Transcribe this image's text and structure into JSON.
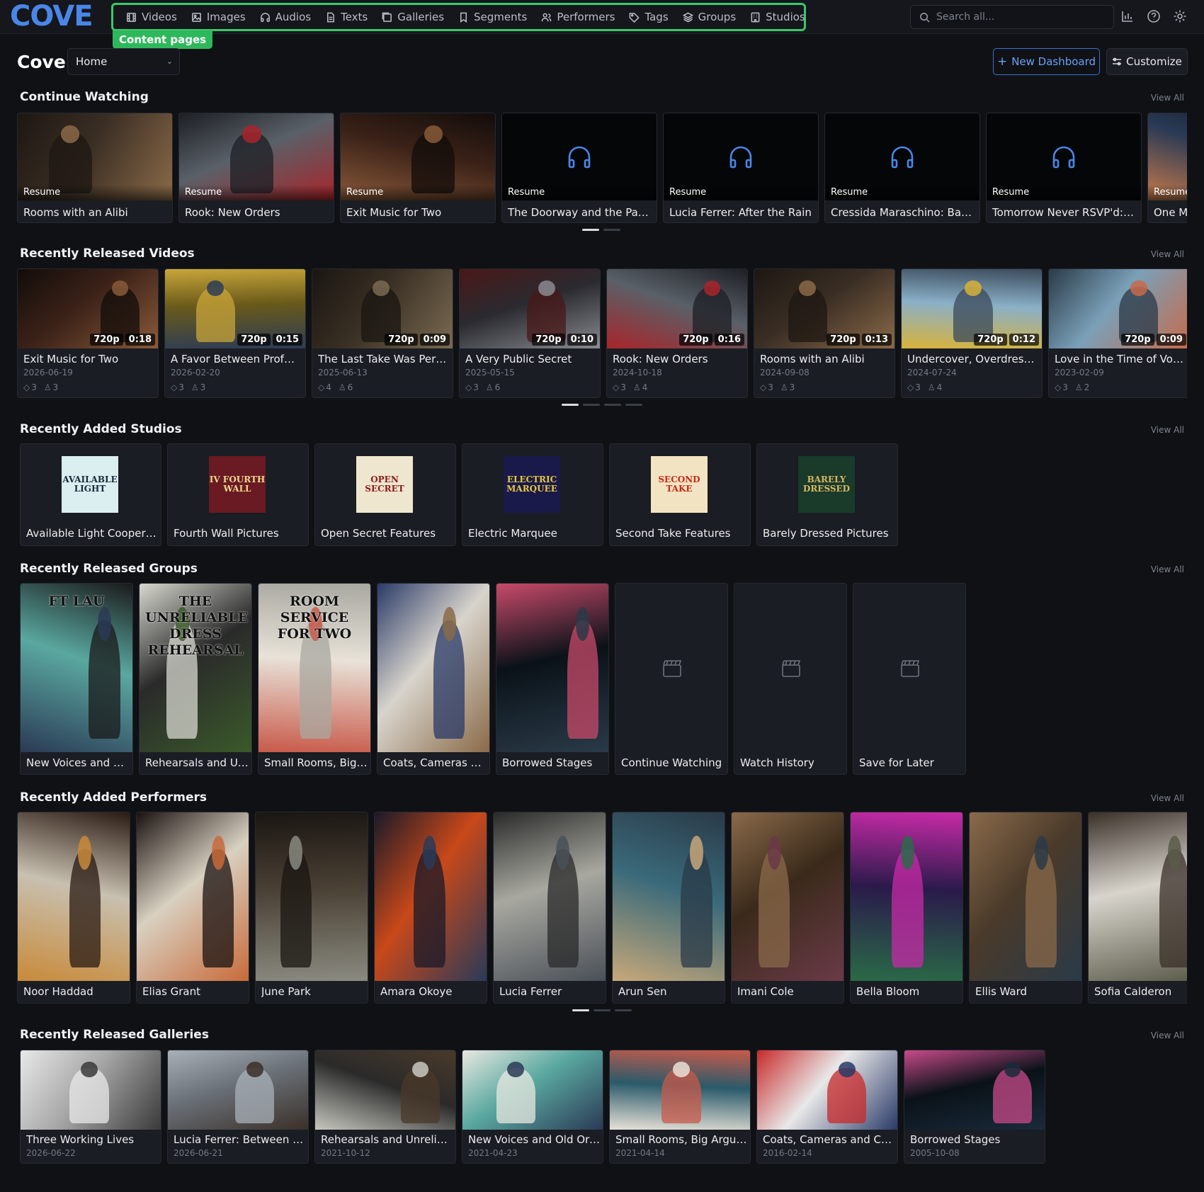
{
  "app": {
    "logo": "COVE",
    "nav_tag": "Content pages"
  },
  "nav": [
    {
      "label": "Videos",
      "icon": "film-icon"
    },
    {
      "label": "Images",
      "icon": "image-icon"
    },
    {
      "label": "Audios",
      "icon": "headphones-icon"
    },
    {
      "label": "Texts",
      "icon": "document-icon"
    },
    {
      "label": "Galleries",
      "icon": "gallery-icon"
    },
    {
      "label": "Segments",
      "icon": "bookmark-icon"
    },
    {
      "label": "Performers",
      "icon": "users-icon"
    },
    {
      "label": "Tags",
      "icon": "tag-icon"
    },
    {
      "label": "Groups",
      "icon": "layers-icon"
    },
    {
      "label": "Studios",
      "icon": "building-icon"
    }
  ],
  "search": {
    "placeholder": "Search all..."
  },
  "header": {
    "title": "Cove",
    "dashboard_select": "Home",
    "new_dashboard": "New Dashboard",
    "customize": "Customize"
  },
  "view_all": "View All",
  "continue_watching": {
    "title": "Continue Watching",
    "resume_label": "Resume",
    "items": [
      {
        "title": "Rooms with an Alibi",
        "kind": "video",
        "palette": [
          "#3a2e24",
          "#8b6a48",
          "#1d1712"
        ]
      },
      {
        "title": "Rook: New Orders",
        "kind": "video",
        "palette": [
          "#5a6068",
          "#a8252a",
          "#1c1f24"
        ]
      },
      {
        "title": "Exit Music for Two",
        "kind": "video",
        "palette": [
          "#3c2218",
          "#8a5a3a",
          "#120c0a"
        ]
      },
      {
        "title": "The Doorway and the Pause",
        "kind": "audio"
      },
      {
        "title": "Lucia Ferrer: After the Rain",
        "kind": "audio"
      },
      {
        "title": "Cressida Maraschino: Back o...",
        "kind": "audio"
      },
      {
        "title": "Tomorrow Never RSVP'd: Lau...",
        "kind": "audio"
      },
      {
        "title": "One Mo",
        "kind": "video",
        "palette": [
          "#2a3a55",
          "#c77a4a",
          "#0f1522"
        ]
      }
    ]
  },
  "recent_videos": {
    "title": "Recently Released Videos",
    "items": [
      {
        "title": "Exit Music for Two",
        "date": "2026-06-19",
        "res": "720p",
        "dur": "0:18",
        "tags": "3",
        "perf": "3",
        "palette": [
          "#3c2218",
          "#8a5a3a",
          "#120c0a"
        ]
      },
      {
        "title": "A Favor Between Professi...",
        "date": "2026-02-20",
        "res": "720p",
        "dur": "0:15",
        "tags": "3",
        "perf": "3",
        "palette": [
          "#6a5a1a",
          "#2c3c55",
          "#c9a63a"
        ]
      },
      {
        "title": "The Last Take Was Perfect",
        "date": "2025-06-13",
        "res": "720p",
        "dur": "0:09",
        "tags": "4",
        "perf": "6",
        "palette": [
          "#3a3024",
          "#7a6a52",
          "#1a1612"
        ]
      },
      {
        "title": "A Very Public Secret",
        "date": "2025-05-15",
        "res": "720p",
        "dur": "0:10",
        "tags": "3",
        "perf": "6",
        "palette": [
          "#2a2a30",
          "#8a8a92",
          "#4a1818"
        ]
      },
      {
        "title": "Rook: New Orders",
        "date": "2024-10-18",
        "res": "720p",
        "dur": "0:16",
        "tags": "3",
        "perf": "4",
        "palette": [
          "#5a6068",
          "#a8252a",
          "#1c1f24"
        ]
      },
      {
        "title": "Rooms with an Alibi",
        "date": "2024-09-08",
        "res": "720p",
        "dur": "0:13",
        "tags": "3",
        "perf": "3",
        "palette": [
          "#3a2e24",
          "#8b6a48",
          "#1d1712"
        ]
      },
      {
        "title": "Undercover, Overdressed",
        "date": "2024-07-24",
        "res": "720p",
        "dur": "0:12",
        "tags": "3",
        "perf": "4",
        "palette": [
          "#8ab0c8",
          "#d8b23a",
          "#3a4a5a"
        ]
      },
      {
        "title": "Love in the Time of Voice...",
        "date": "2023-02-09",
        "res": "720p",
        "dur": "0:09",
        "tags": "3",
        "perf": "2",
        "palette": [
          "#7aa0b8",
          "#c86a4a",
          "#2a3a48"
        ]
      }
    ]
  },
  "recent_studios": {
    "title": "Recently Added Studios",
    "items": [
      {
        "name": "Available Light Cooperative",
        "logo": "AVAILABLE LIGHT",
        "bg": "#dbeef0",
        "fg": "#1a2a3a"
      },
      {
        "name": "Fourth Wall Pictures",
        "logo": "IV FOURTH WALL",
        "bg": "#6a1a22",
        "fg": "#f0d890"
      },
      {
        "name": "Open Secret Features",
        "logo": "OPEN SECRET",
        "bg": "#efe6cf",
        "fg": "#8a1a1a"
      },
      {
        "name": "Electric Marquee",
        "logo": "ELECTRIC MARQUEE",
        "bg": "#1a1a4a",
        "fg": "#e8c83a"
      },
      {
        "name": "Second Take Features",
        "logo": "SECOND TAKE",
        "bg": "#f2e4c2",
        "fg": "#c8281a"
      },
      {
        "name": "Barely Dressed Pictures",
        "logo": "BARELY DRESSED",
        "bg": "#1a3a2a",
        "fg": "#d8b860"
      }
    ]
  },
  "recent_groups": {
    "title": "Recently Released Groups",
    "items": [
      {
        "name": "New Voices and Old...",
        "palette": [
          "#5aa8a0",
          "#2a3a55",
          "#1a1a1a"
        ],
        "text": "FT LAU"
      },
      {
        "name": "Rehearsals and Unr...",
        "palette": [
          "#2a2a2a",
          "#3a5a2a",
          "#d8d8d0"
        ],
        "text": "THE UNRELIABLE DRESS REHEARSAL"
      },
      {
        "name": "Small Rooms, Big A...",
        "palette": [
          "#e8e2d8",
          "#c85a4a",
          "#a8a8a0"
        ],
        "text": "ROOM SERVICE FOR TWO"
      },
      {
        "name": "Coats, Cameras and...",
        "palette": [
          "#d8d4cc",
          "#8a6a48",
          "#2a3a68"
        ],
        "text": ""
      },
      {
        "name": "Borrowed Stages",
        "palette": [
          "#0a1218",
          "#2a3a48",
          "#c84a6a"
        ],
        "text": ""
      },
      {
        "name": "Continue Watching",
        "empty": true
      },
      {
        "name": "Watch History",
        "empty": true
      },
      {
        "name": "Save for Later",
        "empty": true
      }
    ]
  },
  "recent_performers": {
    "title": "Recently Added Performers",
    "items": [
      {
        "name": "Noor Haddad",
        "palette": [
          "#c8c0b0",
          "#c88a3a",
          "#2a1a12"
        ]
      },
      {
        "name": "Elias Grant",
        "palette": [
          "#d8d0c0",
          "#c86a3a",
          "#1a1210"
        ]
      },
      {
        "name": "June Park",
        "palette": [
          "#4a4034",
          "#8a8a80",
          "#1a1612"
        ]
      },
      {
        "name": "Amara Okoye",
        "palette": [
          "#c8481a",
          "#2a3a58",
          "#1a1a28"
        ]
      },
      {
        "name": "Lucia Ferrer",
        "palette": [
          "#a8a8a0",
          "#4a5058",
          "#2a2a2a"
        ]
      },
      {
        "name": "Arun Sen",
        "palette": [
          "#3a6a7a",
          "#c8a87a",
          "#2a3a48"
        ]
      },
      {
        "name": "Imani Cole",
        "palette": [
          "#3a2a1a",
          "#6a3a48",
          "#8a6a4a"
        ]
      },
      {
        "name": "Bella Bloom",
        "palette": [
          "#2a1a4a",
          "#2a6a48",
          "#c82aa8"
        ]
      },
      {
        "name": "Ellis Ward",
        "palette": [
          "#4a3a2a",
          "#2a3a48",
          "#8a6a4a"
        ]
      },
      {
        "name": "Sofia Calderon",
        "palette": [
          "#d8d4cc",
          "#5a5a4a",
          "#3a3028"
        ]
      }
    ]
  },
  "recent_galleries": {
    "title": "Recently Released Galleries",
    "items": [
      {
        "name": "Three Working Lives",
        "date": "2026-06-22",
        "palette": [
          "#a8a8a8",
          "#3a3a3a",
          "#e8e8e8"
        ]
      },
      {
        "name": "Lucia Ferrer: Between Calls",
        "date": "2026-06-21",
        "palette": [
          "#6a7078",
          "#3a3028",
          "#a8b0b8"
        ]
      },
      {
        "name": "Rehearsals and Unreliabl...",
        "date": "2021-10-12",
        "palette": [
          "#2a2a2a",
          "#c8c8c0",
          "#4a3a2a"
        ]
      },
      {
        "name": "New Voices and Old Orders",
        "date": "2021-04-23",
        "palette": [
          "#5aa8a0",
          "#2a3a55",
          "#e8e8e0"
        ]
      },
      {
        "name": "Small Rooms, Big Argume...",
        "date": "2021-04-14",
        "palette": [
          "#2a5a6a",
          "#e8e2d8",
          "#c85a4a"
        ]
      },
      {
        "name": "Coats, Cameras and Cont...",
        "date": "2016-02-14",
        "palette": [
          "#e8e8e8",
          "#2a3a68",
          "#c82a2a"
        ]
      },
      {
        "name": "Borrowed Stages",
        "date": "2005-10-08",
        "palette": [
          "#0a1218",
          "#1a2a3a",
          "#c84a8a"
        ]
      }
    ]
  }
}
